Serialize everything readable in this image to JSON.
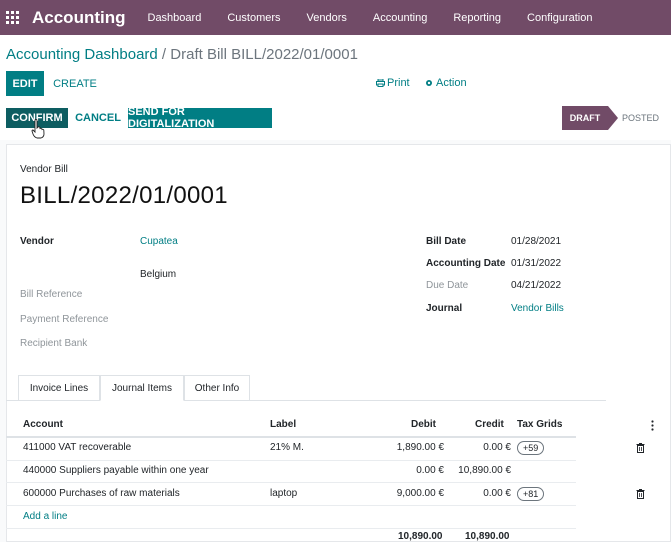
{
  "nav": {
    "brand": "Accounting",
    "items": [
      "Dashboard",
      "Customers",
      "Vendors",
      "Accounting",
      "Reporting",
      "Configuration"
    ]
  },
  "breadcrumb": {
    "parent": "Accounting Dashboard",
    "separator": " / ",
    "current": "Draft Bill BILL/2022/01/0001"
  },
  "toolbar": {
    "edit": "EDIT",
    "create": "CREATE",
    "print": "Print",
    "action": "Action"
  },
  "actions": {
    "confirm": "CONFIRM",
    "cancel": "CANCEL",
    "digitalize": "SEND FOR DIGITALIZATION"
  },
  "status": {
    "draft": "DRAFT",
    "posted": "POSTED"
  },
  "form": {
    "type_label": "Vendor Bill",
    "number": "BILL/2022/01/0001",
    "vendor_label": "Vendor",
    "vendor_name": "Cupatea",
    "vendor_country": "Belgium",
    "bill_reference_label": "Bill Reference",
    "payment_reference_label": "Payment Reference",
    "recipient_bank_label": "Recipient Bank",
    "bill_date_label": "Bill Date",
    "bill_date": "01/28/2021",
    "accounting_date_label": "Accounting Date",
    "accounting_date": "01/31/2022",
    "due_date_label": "Due Date",
    "due_date": "04/21/2022",
    "journal_label": "Journal",
    "journal": "Vendor Bills"
  },
  "tabs": [
    "Invoice Lines",
    "Journal Items",
    "Other Info"
  ],
  "table": {
    "headers": [
      "Account",
      "Label",
      "Debit",
      "Credit",
      "Tax Grids"
    ],
    "rows": [
      {
        "account": "411000 VAT recoverable",
        "label": "21% M.",
        "debit": "1,890.00 €",
        "credit": "0.00 €",
        "tax": "+59"
      },
      {
        "account": "440000 Suppliers payable within one year",
        "label": "",
        "debit": "0.00 €",
        "credit": "10,890.00 €",
        "tax": ""
      },
      {
        "account": "600000 Purchases of raw materials",
        "label": "laptop",
        "debit": "9,000.00 €",
        "credit": "0.00 €",
        "tax": "+81"
      }
    ],
    "add_line": "Add a line",
    "total_debit": "10,890.00",
    "total_credit": "10,890.00"
  },
  "colors": {
    "brand": "#714b67",
    "accent": "#017e84"
  }
}
